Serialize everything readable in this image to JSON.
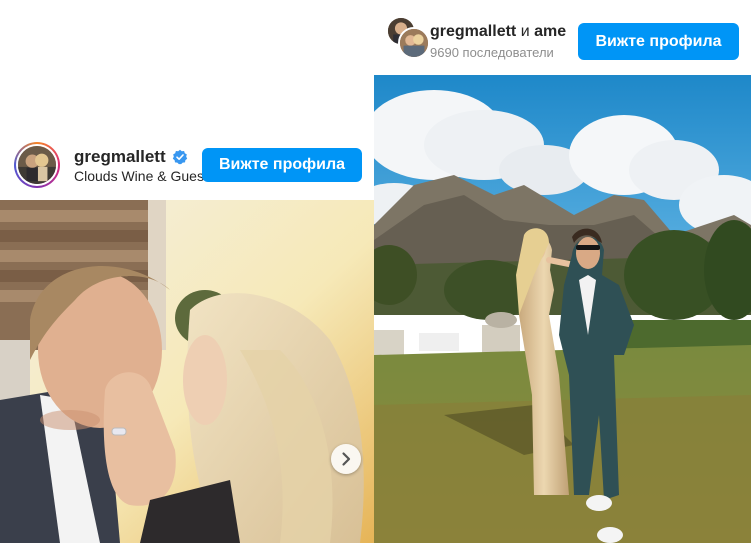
{
  "left_post": {
    "username": "gregmallett",
    "location": "Clouds Wine & Guest Estate",
    "view_profile_label": "Вижте профила",
    "icons": {
      "verified": "verified-badge-icon",
      "carousel": "chevron-right-icon"
    }
  },
  "right_post": {
    "username": "gregmallett",
    "coauthor_connector": "и",
    "coauthor_partial": "ame",
    "followers": "9690 последователи",
    "view_profile_label": "Вижте профила"
  },
  "colors": {
    "button": "#0095f6",
    "verified": "#3897f0",
    "text": "#262626",
    "muted": "#8e8e8e"
  }
}
